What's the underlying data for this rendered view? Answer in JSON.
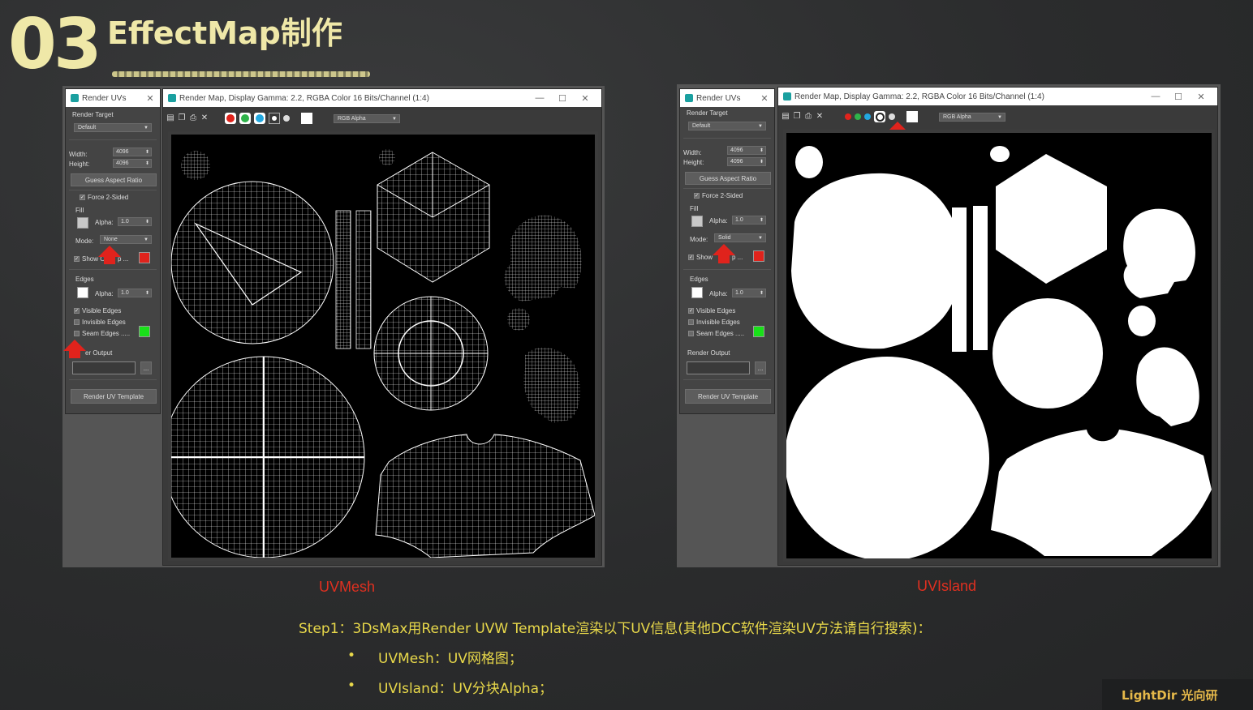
{
  "slide": {
    "number": "03",
    "title": "EffectMap制作",
    "caption_left": "UVMesh",
    "caption_right": "UVIsland",
    "step": "Step1：3DsMax用Render UVW Template渲染以下UV信息(其他DCC软件渲染UV方法请自行搜索)：",
    "bullets": [
      "UVMesh：UV网格图；",
      "UVIsland：UV分块Alpha；"
    ],
    "bullet_glyph": "•",
    "brand": "LightDir 光向研"
  },
  "render_uvs": {
    "title": "Render UVs",
    "close": "✕",
    "render_target_label": "Render Target",
    "render_target_value": "Default",
    "width_label": "Width:",
    "width_value": "4096",
    "height_label": "Height:",
    "height_value": "4096",
    "guess_button": "Guess Aspect Ratio",
    "force_two_sided": "Force 2-Sided",
    "fill_label": "Fill",
    "alpha_label": "Alpha:",
    "alpha_value": "1.0",
    "mode_label": "Mode:",
    "show_label_left": "Show O",
    "show_label_left_tail": "p ...",
    "show_label_right": "Show",
    "show_label_right_tail": "p ...",
    "edges_label": "Edges",
    "edges_alpha_value": "1.0",
    "visible_edges": "Visible Edges",
    "invisible_edges": "Invisible Edges",
    "seam_edges": "Seam Edges .....",
    "render_output_left": "er Output",
    "render_output_right": "Render Output",
    "browse": "...",
    "render_button": "Render UV Template",
    "check": "✓"
  },
  "left": {
    "mode_value": "None",
    "fill_color": "#c8c8c8",
    "mode_color": "#e0231c",
    "seam_color": "#19e019"
  },
  "right": {
    "mode_value": "Solid",
    "fill_color": "#c8c8c8",
    "mode_color": "#e0231c",
    "seam_color": "#19e019"
  },
  "render_map": {
    "title": "Render Map, Display Gamma: 2.2, RGBA Color 16 Bits/Channel (1:4)",
    "minimize": "—",
    "maximize": "☐",
    "close": "✕",
    "channel_value": "RGB Alpha",
    "icons": [
      "save-icon",
      "copy-icon",
      "print-icon",
      "clear-icon"
    ]
  },
  "colors": {
    "red": "#e0231c",
    "green": "#2fb34a",
    "blue": "#22a8e0",
    "accent_yellow": "#e8d84a",
    "caption_red": "#e03020"
  }
}
